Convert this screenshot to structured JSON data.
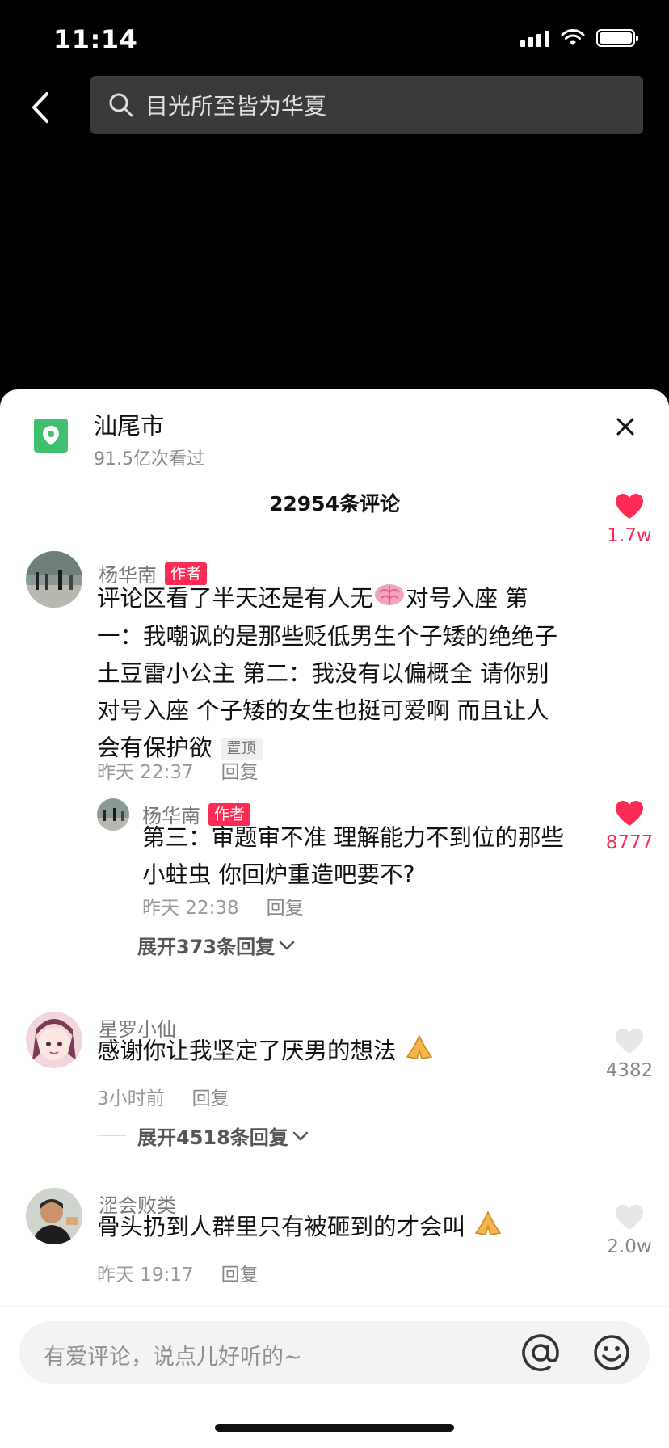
{
  "status": {
    "time": "11:14"
  },
  "search": {
    "query": "目光所至皆为华夏"
  },
  "location": {
    "title": "汕尾市",
    "views": "91.5亿次看过"
  },
  "comments_header": {
    "count_label": "22954条评论"
  },
  "comments": [
    {
      "user": "杨华南",
      "badge": "作者",
      "text_line1_a": "评论区看了半天还是有人无",
      "text_line1_b": "对号入座 第",
      "text_line2": "一：我嘲讽的是那些贬低男生个子矮的绝绝子",
      "text_line3": "土豆雷小公主 第二：我没有以偏概全 请你别",
      "text_line4": "对号入座 个子矮的女生也挺可爱啊 而且让人",
      "text_line5": "会有保护欲",
      "pin": "置顶",
      "time": "昨天 22:37",
      "reply": "回复",
      "likes": "1.7w",
      "liked": true
    },
    {
      "user": "杨华南",
      "badge": "作者",
      "text_line1": "第三：审题审不准 理解能力不到位的那些",
      "text_line2": "小蛀虫 你回炉重造吧要不?",
      "time": "昨天 22:38",
      "reply": "回复",
      "likes": "8777",
      "liked": true
    },
    {
      "expand_label": "展开373条回复"
    },
    {
      "user": "星罗小仙",
      "text": "感谢你让我坚定了厌男的想法",
      "time": "3小时前",
      "reply": "回复",
      "likes": "4382",
      "liked": false
    },
    {
      "expand_label": "展开4518条回复"
    },
    {
      "user": "涩会败类",
      "text": "骨头扔到人群里只有被砸到的才会叫",
      "time": "昨天 19:17",
      "reply": "回复",
      "likes": "2.0w",
      "liked": false
    }
  ],
  "input": {
    "placeholder": "有爱评论，说点儿好听的~"
  },
  "colors": {
    "like_red": "#fe2c55",
    "location_green": "#3fbf6f",
    "muted": "#999999"
  }
}
